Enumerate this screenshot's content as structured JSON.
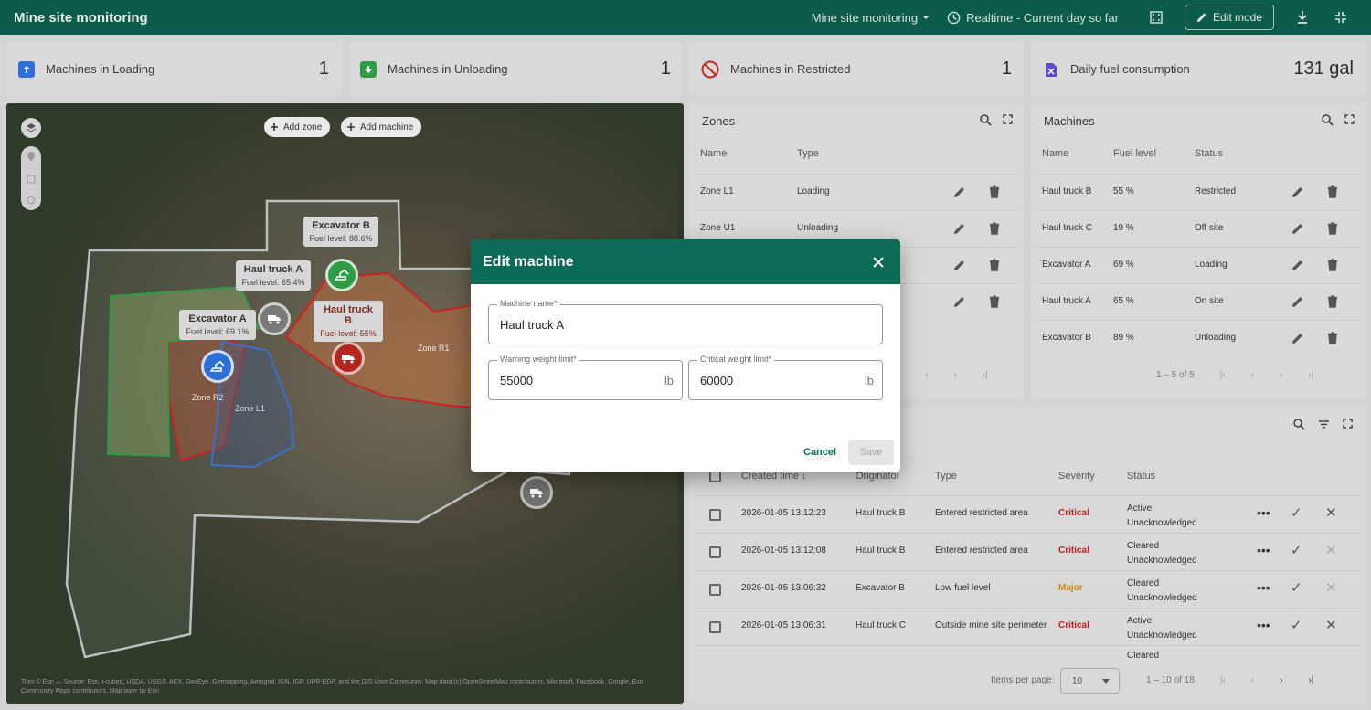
{
  "topbar": {
    "title": "Mine site monitoring",
    "dashboard_select": "Mine site monitoring",
    "time_window": "Realtime - Current day so far",
    "edit_mode_label": "Edit mode"
  },
  "stats": [
    {
      "label": "Machines in Loading",
      "value": "1",
      "color": "#2e6fd6"
    },
    {
      "label": "Machines in Unloading",
      "value": "1",
      "color": "#2e9b45"
    },
    {
      "label": "Machines in Restricted",
      "value": "1",
      "color": "#c62828"
    },
    {
      "label": "Daily fuel consumption",
      "value": "131 gal",
      "color": "#5b4bd1"
    }
  ],
  "map": {
    "add_zone": "Add zone",
    "add_machine": "Add machine",
    "zone_labels": [
      "Zone R1",
      "Zone R2",
      "Zone L1"
    ],
    "machines": [
      {
        "name": "Excavator B",
        "fuel": "Fuel level: 88.6%"
      },
      {
        "name": "Haul truck A",
        "fuel": "Fuel level: 65.4%"
      },
      {
        "name": "Excavator A",
        "fuel": "Fuel level: 69.1%"
      },
      {
        "name": "Haul truck B",
        "fuel": "Fuel level: 55%"
      }
    ],
    "attribution": "Tiles © Esri — Source: Esri, i-cubed, USDA, USGS, AEX, GeoEye, Getmapping, Aerogrid, IGN, IGP, UPR-EGP, and the GIS User Community, Map data (c) OpenStreetMap contributors, Microsoft, Facebook, Google, Esri Community Maps contributors, Map layer by Esri"
  },
  "zones": {
    "title": "Zones",
    "columns": [
      "Name",
      "Type"
    ],
    "rows": [
      {
        "name": "Zone L1",
        "type": "Loading"
      },
      {
        "name": "Zone U1",
        "type": "Unloading"
      }
    ]
  },
  "machines": {
    "title": "Machines",
    "columns": [
      "Name",
      "Fuel level",
      "Status"
    ],
    "rows": [
      {
        "name": "Haul truck B",
        "fuel": "55 %",
        "status": "Restricted"
      },
      {
        "name": "Haul truck C",
        "fuel": "19 %",
        "status": "Off site"
      },
      {
        "name": "Excavator A",
        "fuel": "69 %",
        "status": "Loading"
      },
      {
        "name": "Haul truck A",
        "fuel": "65 %",
        "status": "On site"
      },
      {
        "name": "Excavator B",
        "fuel": "89 %",
        "status": "Unloading"
      }
    ],
    "pager": "1 – 5 of 5"
  },
  "alarms": {
    "columns": [
      "Created time",
      "Originator",
      "Type",
      "Severity",
      "Status"
    ],
    "rows": [
      {
        "time": "2026-01-05 13:12:23",
        "originator": "Haul truck B",
        "type": "Entered restricted area",
        "severity": "Critical",
        "status1": "Active",
        "status2": "Unacknowledged"
      },
      {
        "time": "2026-01-05 13:12:08",
        "originator": "Haul truck B",
        "type": "Entered restricted area",
        "severity": "Critical",
        "status1": "Cleared",
        "status2": "Unacknowledged"
      },
      {
        "time": "2026-01-05 13:06:32",
        "originator": "Excavator B",
        "type": "Low fuel level",
        "severity": "Major",
        "status1": "Cleared",
        "status2": "Unacknowledged"
      },
      {
        "time": "2026-01-05 13:06:31",
        "originator": "Haul truck C",
        "type": "Outside mine site perimeter",
        "severity": "Critical",
        "status1": "Active",
        "status2": "Unacknowledged"
      }
    ],
    "partial_status": "Cleared",
    "items_per_page_label": "Items per page:",
    "items_per_page": "10",
    "pager": "1 – 10 of 18"
  },
  "dialog": {
    "title": "Edit machine",
    "name_label": "Machine name*",
    "name_value": "Haul truck A",
    "warn_label": "Warning weight limit*",
    "warn_value": "55000",
    "crit_label": "Critical weight limit*",
    "crit_value": "60000",
    "unit": "lb",
    "cancel": "Cancel",
    "save": "Save"
  }
}
